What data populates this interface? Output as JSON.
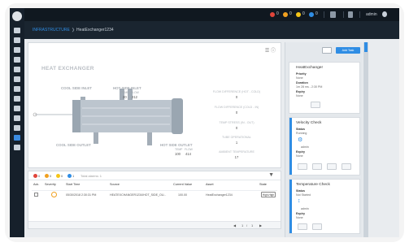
{
  "topbar": {
    "alerts": [
      {
        "color": "#e0453a",
        "count": "0"
      },
      {
        "color": "#f0a020",
        "count": "0"
      },
      {
        "color": "#f5c518",
        "count": "0"
      },
      {
        "color": "#2f8de4",
        "count": "0"
      }
    ],
    "user_label": "admin"
  },
  "breadcrumb": {
    "parent": "INFRASTRUCTURE",
    "current": "HeatExchanger1234"
  },
  "diagram": {
    "title": "HEAT EXCHANGER",
    "cool_side_inlet": "COOL SIDE INLET",
    "hot_side_inlet": "HOT SIDE INLET",
    "hot_inlet_temp_label": "TEMP",
    "hot_inlet_flow_label": "FLOW",
    "hot_inlet_temp": "20",
    "hot_inlet_flow": "212",
    "cool_side_outlet": "COOL SIDE OUTLET",
    "hot_side_outlet": "HOT SIDE OUTLET",
    "hot_outlet_temp_label": "TEMP",
    "hot_outlet_flow_label": "FLOW",
    "hot_outlet_temp": "100",
    "hot_outlet_flow": "414",
    "metrics": [
      {
        "label": "FLOW DIFFERENCE (HOT - COLD)",
        "value": "0"
      },
      {
        "label": "FLOW DIFFERENCE (COLD - IN)",
        "value": "0"
      },
      {
        "label": "TEMP STRESS (IN - OUT)",
        "value": "0"
      },
      {
        "label": "TUBE OPERATIONAL",
        "value": "1"
      },
      {
        "label": "AMBIENT TEMPERATURE",
        "value": "17"
      }
    ]
  },
  "alarms": {
    "counts": [
      {
        "color": "#e0453a",
        "count": "0"
      },
      {
        "color": "#f0a020",
        "count": "0"
      },
      {
        "color": "#f5c518",
        "count": "0"
      },
      {
        "color": "#2f8de4",
        "count": "1"
      }
    ],
    "search_placeholder": "Total alarms: 1",
    "columns": [
      "Ack.",
      "Severity",
      "Start Time",
      "Source",
      "Current Value",
      "Asset",
      "State"
    ],
    "rows": [
      {
        "start_time": "05/30/2018 2:30:31 PM",
        "source": "HEATEXCHANGER1234/HOT_SIDE_OU...",
        "current_value": "100.00",
        "asset": "HeatExchanger1234",
        "state": "High-High"
      }
    ],
    "pager": {
      "page": "1",
      "of": "1"
    }
  },
  "right_panel": {
    "add_label": "Add Task",
    "asset_card": {
      "title": "HeatExchanger",
      "priority_label": "Priority",
      "priority_value": "None",
      "duration_label": "Duration",
      "duration_value": "1m 28 ms - 2:30 PM",
      "expiry_label": "Expiry",
      "expiry_value": "None"
    },
    "tasks": [
      {
        "title": "Velocity Check",
        "status_label": "Status",
        "status_value": "Running",
        "user": "admin",
        "expiry_label": "Expiry",
        "expiry_value": "None"
      },
      {
        "title": "Temperature Check",
        "status_label": "Status",
        "status_value": "Not Started",
        "user": "admin",
        "expiry_label": "Expiry",
        "expiry_value": "None"
      }
    ]
  }
}
